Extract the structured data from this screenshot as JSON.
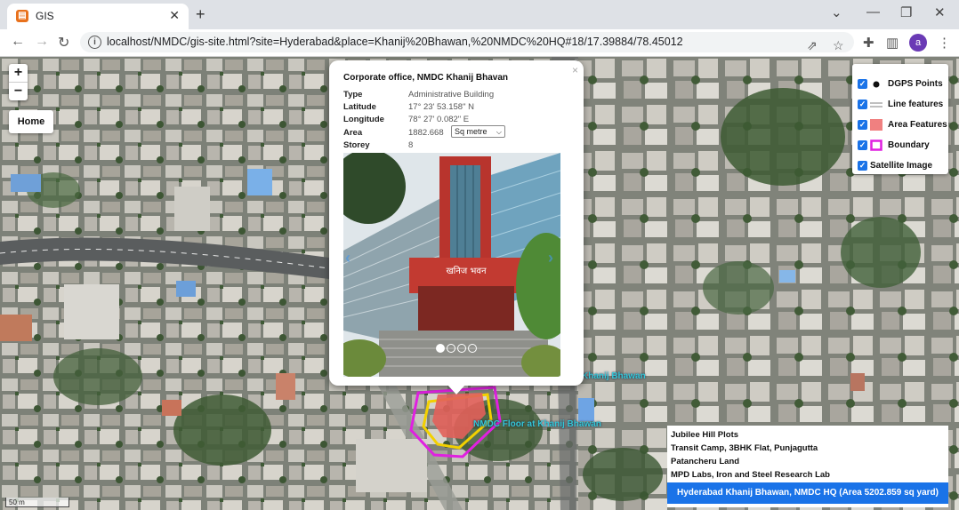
{
  "browser": {
    "tab_title": "GIS",
    "tab_close": "✕",
    "new_tab": "+",
    "url": "localhost/NMDC/gis-site.html?site=Hyderabad&place=Khanij%20Bhawan,%20NMDC%20HQ#18/17.39884/78.45012",
    "avatar_letter": "a",
    "window_controls": [
      "⌄",
      "—",
      "❐",
      "✕"
    ]
  },
  "map": {
    "zoom_in": "+",
    "zoom_out": "−",
    "home_label": "Home",
    "scale_label": "50 m",
    "layers": [
      {
        "label": "DGPS Points",
        "checked": true,
        "symbol": "dot"
      },
      {
        "label": "Line features",
        "checked": true,
        "symbol": "line"
      },
      {
        "label": "Area Features",
        "checked": true,
        "symbol": "area"
      },
      {
        "label": "Boundary",
        "checked": true,
        "symbol": "boundary"
      },
      {
        "label": "Satellite Image",
        "checked": true,
        "symbol": "none"
      }
    ],
    "labels": {
      "bhawan": "Khanij Bhawan",
      "floor": "NMDC Floor at Khanij Bhawan"
    },
    "colors": {
      "accent": "#1a73e8",
      "area_fill": "#f08080",
      "boundary": "#e020e0",
      "floor_outline": "#f2d000",
      "label": "#34c7d6"
    }
  },
  "popup": {
    "title": "Corporate office, NMDC Khanij Bhavan",
    "close": "×",
    "rows": [
      {
        "key": "Type",
        "value": "Administrative Building"
      },
      {
        "key": "Latitude",
        "value": "17° 23' 53.158\" N"
      },
      {
        "key": "Longitude",
        "value": "78° 27' 0.082\" E"
      },
      {
        "key": "Area",
        "value": "1882.668"
      },
      {
        "key": "Storey",
        "value": "8"
      }
    ],
    "area_unit": "Sq metre",
    "photo_sign": "खनिज भवन",
    "carousel": {
      "count": 4,
      "active": 0
    }
  },
  "plots": {
    "items": [
      "Jubilee Hill Plots",
      "Transit Camp, 3BHK Flat, Punjagutta",
      "Patancheru Land",
      "MPD Labs, Iron and Steel Research Lab"
    ],
    "active": "Hyderabad Khanij Bhawan, NMDC HQ (Area 5202.859 sq yard)"
  }
}
